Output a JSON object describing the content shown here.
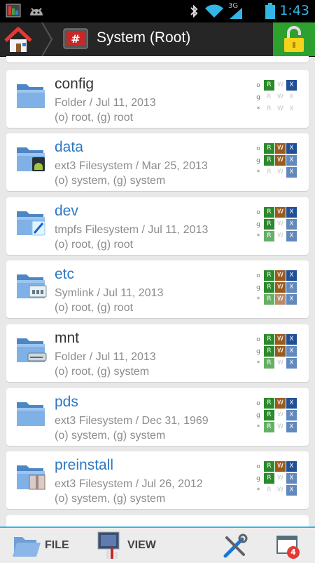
{
  "status_bar": {
    "time": "1:43",
    "network": "3G"
  },
  "header": {
    "title": "System (Root)"
  },
  "items": [
    {
      "name": "config",
      "meta": "Folder / Jul 11, 2013",
      "owner": "(o) root, (g) root",
      "perms": [
        [
          "R",
          "",
          ""
        ],
        [
          "R",
          "W",
          "X"
        ],
        [
          "R",
          "W",
          "X"
        ]
      ]
    },
    {
      "name": "data",
      "meta": "ext3 Filesystem / Mar 25, 2013",
      "owner": "(o) system, (g) system",
      "perms": [
        [
          "R",
          "W",
          "X"
        ],
        [
          "R",
          "W",
          "X"
        ],
        [
          "R",
          "W",
          "X"
        ]
      ]
    },
    {
      "name": "dev",
      "meta": "tmpfs Filesystem / Jul 11, 2013",
      "owner": "(o) root, (g) root",
      "perms": [
        [
          "R",
          "W",
          "X"
        ],
        [
          "R",
          "W",
          "X"
        ],
        [
          "R",
          "W",
          "X"
        ]
      ]
    },
    {
      "name": "etc",
      "meta": "Symlink / Jul 11, 2013",
      "owner": "(o) root, (g) root",
      "perms": [
        [
          "R",
          "W",
          "X"
        ],
        [
          "R",
          "W",
          "X"
        ],
        [
          "R",
          "W",
          "X"
        ]
      ]
    },
    {
      "name": "mnt",
      "meta": "Folder / Jul 11, 2013",
      "owner": "(o) root, (g) system",
      "perms": [
        [
          "R",
          "W",
          "X"
        ],
        [
          "R",
          "W",
          "X"
        ],
        [
          "R",
          "W",
          "X"
        ]
      ]
    },
    {
      "name": "pds",
      "meta": "ext3 Filesystem / Dec 31, 1969",
      "owner": "(o) system, (g) system",
      "perms": [
        [
          "R",
          "W",
          "X"
        ],
        [
          "R",
          "W",
          "X"
        ],
        [
          "R",
          "W",
          "X"
        ]
      ]
    },
    {
      "name": "preinstall",
      "meta": "ext3 Filesystem / Jul 26, 2012",
      "owner": "(o) system, (g) system",
      "perms": [
        [
          "R",
          "W",
          "X"
        ],
        [
          "R",
          "W",
          "X"
        ],
        [
          "R",
          "W",
          "X"
        ]
      ]
    }
  ],
  "perm_labels": [
    "o",
    "g",
    "*"
  ],
  "toolbar": {
    "file_label": "FILE",
    "view_label": "VIEW",
    "windows_count": "4"
  }
}
